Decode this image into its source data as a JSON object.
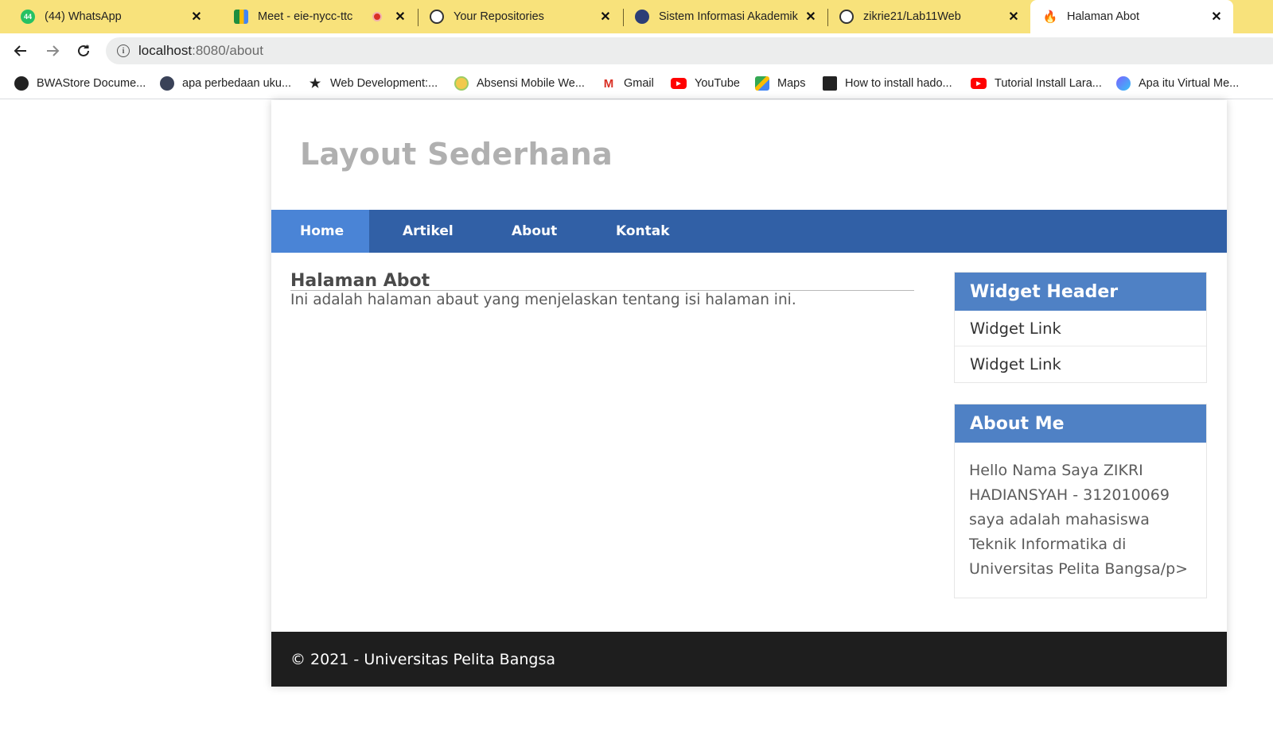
{
  "browser": {
    "tabs": [
      {
        "title": "(44) WhatsApp",
        "icon": "whatsapp-icon",
        "badge": "44"
      },
      {
        "title": "Meet - eie-nycc-ttc",
        "icon": "google-meet-icon"
      },
      {
        "title": "Your Repositories",
        "icon": "github-icon"
      },
      {
        "title": "Sistem Informasi Akademik",
        "icon": "university-logo-icon"
      },
      {
        "title": "zikrie21/Lab11Web",
        "icon": "github-icon"
      },
      {
        "title": "Halaman Abot",
        "icon": "codeigniter-flame-icon"
      }
    ],
    "url": {
      "host": "localhost",
      "path": ":8080/about"
    },
    "bookmarks": [
      {
        "label": "BWAStore Docume...",
        "icon": "bookmark-favicon-icon"
      },
      {
        "label": "apa perbedaan uku...",
        "icon": "bookmark-favicon-icon"
      },
      {
        "label": "Web Development:...",
        "icon": "star-favicon-icon"
      },
      {
        "label": "Absensi Mobile We...",
        "icon": "bookmark-favicon-icon"
      },
      {
        "label": "Gmail",
        "icon": "gmail-icon"
      },
      {
        "label": "YouTube",
        "icon": "youtube-icon"
      },
      {
        "label": "Maps",
        "icon": "maps-icon"
      },
      {
        "label": "How to install hado...",
        "icon": "bookmark-favicon-icon"
      },
      {
        "label": "Tutorial Install Lara...",
        "icon": "youtube-icon"
      },
      {
        "label": "Apa itu Virtual Me...",
        "icon": "bookmark-favicon-icon"
      }
    ]
  },
  "site": {
    "title": "Layout Sederhana",
    "nav": [
      {
        "label": "Home",
        "active": true
      },
      {
        "label": "Artikel",
        "active": false
      },
      {
        "label": "About",
        "active": false
      },
      {
        "label": "Kontak",
        "active": false
      }
    ],
    "main": {
      "title": "Halaman Abot",
      "text": "Ini adalah halaman abaut yang menjelaskan tentang isi halaman ini."
    },
    "sidebar": {
      "widget1": {
        "header": "Widget Header",
        "links": [
          "Widget Link",
          "Widget Link"
        ]
      },
      "widget2": {
        "header": "About Me",
        "body": "Hello Nama Saya ZIKRI HADIANSYAH - 312010069 saya adalah mahasiswa Teknik Informatika di Universitas Pelita Bangsa/p>"
      }
    },
    "footer": "© 2021 - Universitas Pelita Bangsa"
  },
  "colors": {
    "tabstrip": "#f8e27b",
    "navbar": "#3160a6",
    "nav_active": "#4a84d6",
    "widget_header": "#4f81c5",
    "footer": "#1e1e1e",
    "site_title": "#b0b0b0"
  }
}
